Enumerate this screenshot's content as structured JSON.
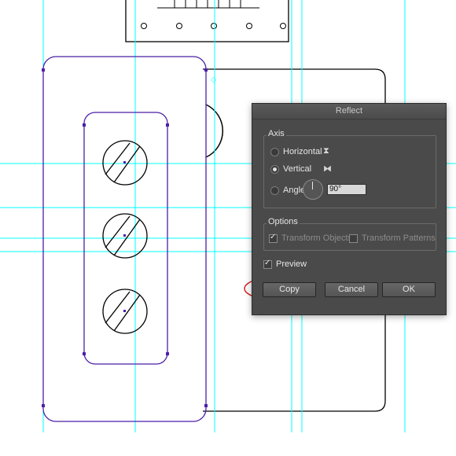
{
  "dialog": {
    "title": "Reflect",
    "axis_group_label": "Axis",
    "axis_options": [
      {
        "label": "Horizontal",
        "selected": false,
        "icon": "horizontal-reflect-icon"
      },
      {
        "label": "Vertical",
        "selected": true,
        "icon": "vertical-reflect-icon"
      },
      {
        "label": "Angle:",
        "selected": false
      }
    ],
    "angle_value": "90°",
    "options_group_label": "Options",
    "transform_objects": {
      "label": "Transform Objects",
      "checked": true,
      "enabled": false
    },
    "transform_patterns": {
      "label": "Transform Patterns",
      "checked": false,
      "enabled": false
    },
    "preview": {
      "label": "Preview",
      "checked": true
    },
    "buttons": {
      "copy": "Copy",
      "cancel": "Cancel",
      "ok": "OK"
    }
  },
  "colors": {
    "guide": "#00ffff",
    "selection": "#4b1fa8",
    "artwork_stroke": "#000000",
    "dialog_bg": "#4a4a4a",
    "highlight_ellipse": "#d42a2a"
  }
}
